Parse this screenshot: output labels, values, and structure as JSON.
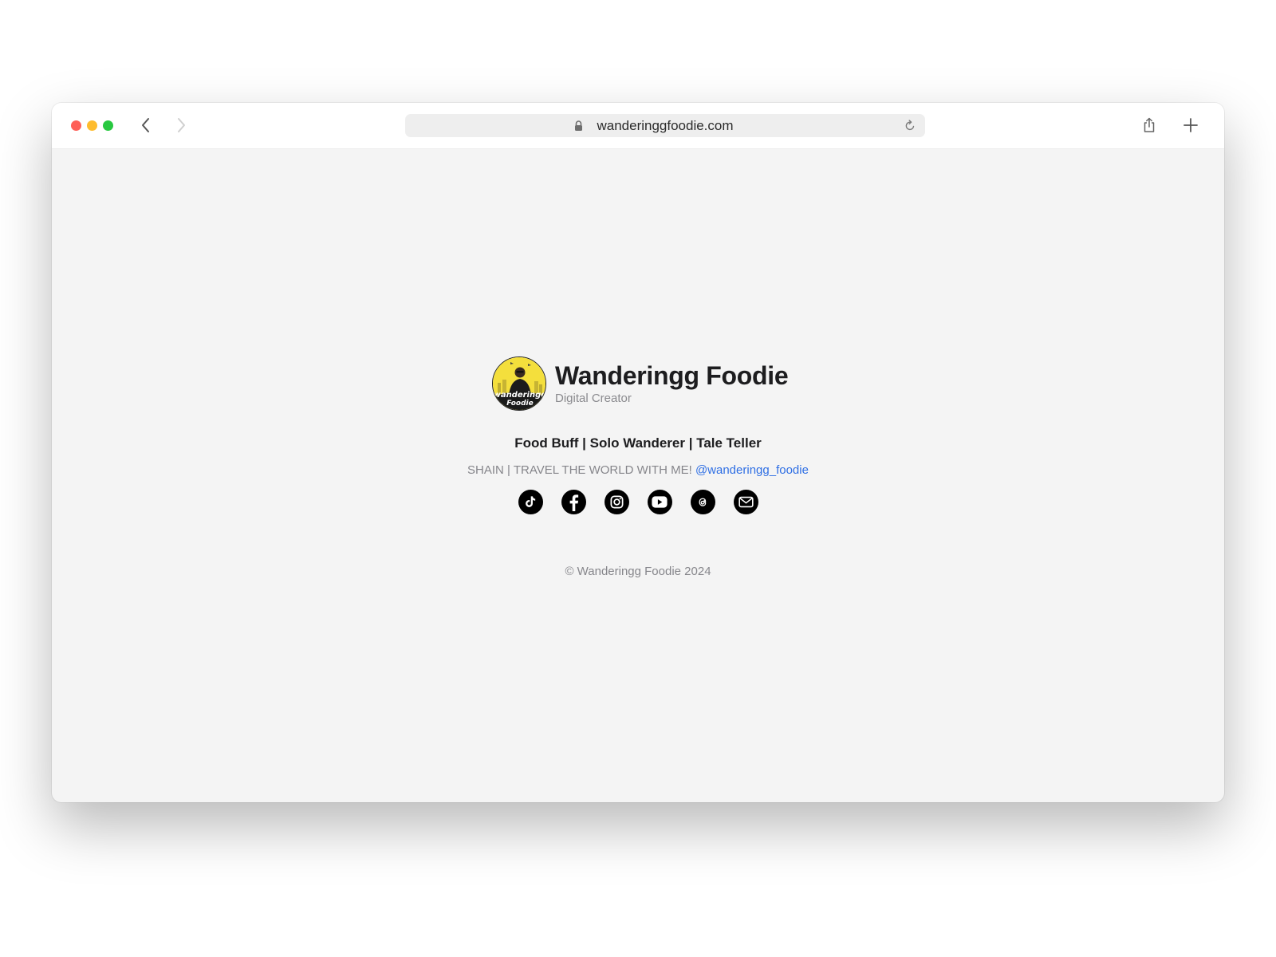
{
  "browser": {
    "url": "wanderinggfoodie.com"
  },
  "profile": {
    "name": "Wanderingg Foodie",
    "role": "Digital Creator",
    "avatar_label_line1": "wanderingg",
    "avatar_label_line2": "Foodie"
  },
  "tagline": "Food Buff | Solo Wanderer | Tale Teller",
  "bio": {
    "text": "SHAIN | TRAVEL THE WORLD WITH ME!",
    "handle": "@wanderingg_foodie"
  },
  "socials": [
    {
      "icon": "tiktok-icon"
    },
    {
      "icon": "facebook-icon"
    },
    {
      "icon": "instagram-icon"
    },
    {
      "icon": "youtube-icon"
    },
    {
      "icon": "threads-icon"
    },
    {
      "icon": "email-icon"
    }
  ],
  "footer": {
    "copyright": "© Wanderingg Foodie 2024"
  },
  "colors": {
    "link": "#2f6fe4",
    "avatar_bg": "#f4df3c",
    "page_bg": "#f4f4f4"
  }
}
